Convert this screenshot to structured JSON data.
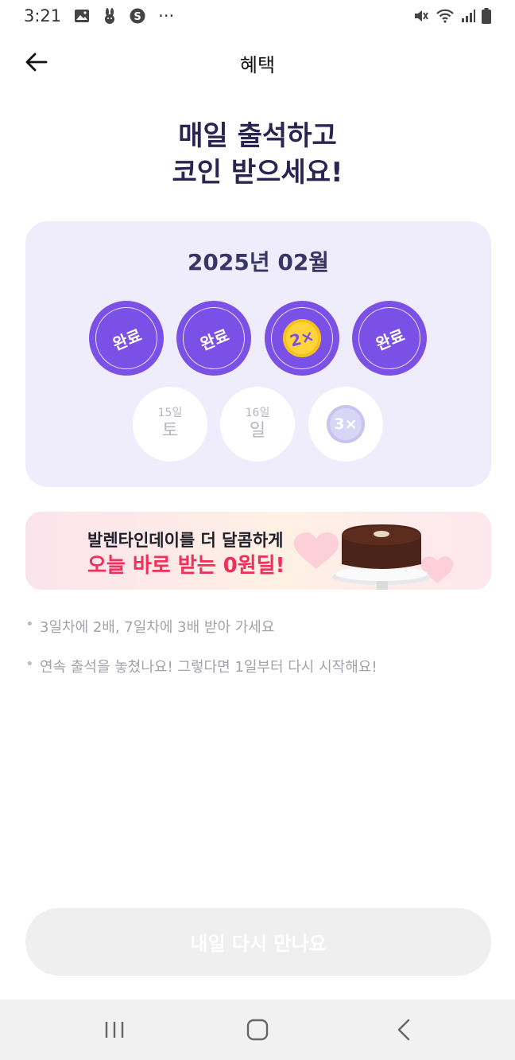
{
  "status_bar": {
    "time": "3:21",
    "more": "···",
    "icons_left": [
      "gallery-icon",
      "rabbit-app-icon",
      "s-app-icon"
    ],
    "icons_right": [
      "mute-icon",
      "wifi-icon",
      "signal-icon",
      "battery-icon"
    ]
  },
  "header": {
    "title": "혜택"
  },
  "headline": {
    "line1": "매일 출석하고",
    "line2": "코인 받으세요!"
  },
  "calendar": {
    "month": "2025년 02월",
    "done_label": "완료",
    "row1": [
      {
        "state": "done",
        "label": "완료"
      },
      {
        "state": "done",
        "label": "완료"
      },
      {
        "state": "bonus-today",
        "coin": "2×"
      },
      {
        "state": "done",
        "label": "완료"
      }
    ],
    "row2": [
      {
        "state": "upcoming",
        "date": "15일",
        "weekday": "토"
      },
      {
        "state": "upcoming",
        "date": "16일",
        "weekday": "일"
      },
      {
        "state": "upcoming-bonus",
        "coin": "3×"
      }
    ]
  },
  "banner": {
    "line1": "발렌타인데이를 더 달콤하게",
    "line2": "오늘 바로 받는 0원딜!"
  },
  "notes": [
    "3일차에 2배, 7일차에 3배 받아 가세요",
    "연속 출석을 놓쳤나요! 그렇다면 1일부터 다시 시작해요!"
  ],
  "cta": {
    "label": "내일 다시 만나요",
    "enabled": false
  },
  "colors": {
    "accent": "#7a50e6",
    "card_bg": "#efedfc",
    "headline": "#2a2452",
    "banner_red": "#f0305a",
    "coin_gold": "#ffd43a"
  }
}
